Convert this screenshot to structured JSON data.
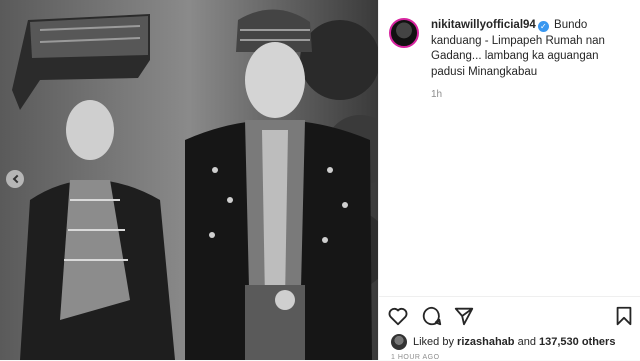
{
  "post": {
    "username": "nikitawillyofficial94",
    "verified_glyph": "✓",
    "caption": "Bundo kanduang - Limpapeh Rumah nan Gadang... lambang ka aguangan padusi Minangkabau",
    "time_ago": "1h",
    "likes_prefix": "Liked by",
    "likes_user": "rizashahab",
    "likes_join": "and",
    "likes_count": "137,530 others",
    "timestamp_cut": "1 HOUR AGO"
  },
  "icons": [
    "heart-icon",
    "comment-icon",
    "share-icon",
    "bookmark-icon",
    "chevron-left-icon"
  ],
  "colors": {
    "accent": "#3897f0",
    "ring": "#d6249f",
    "muted": "#8e8e8e"
  }
}
